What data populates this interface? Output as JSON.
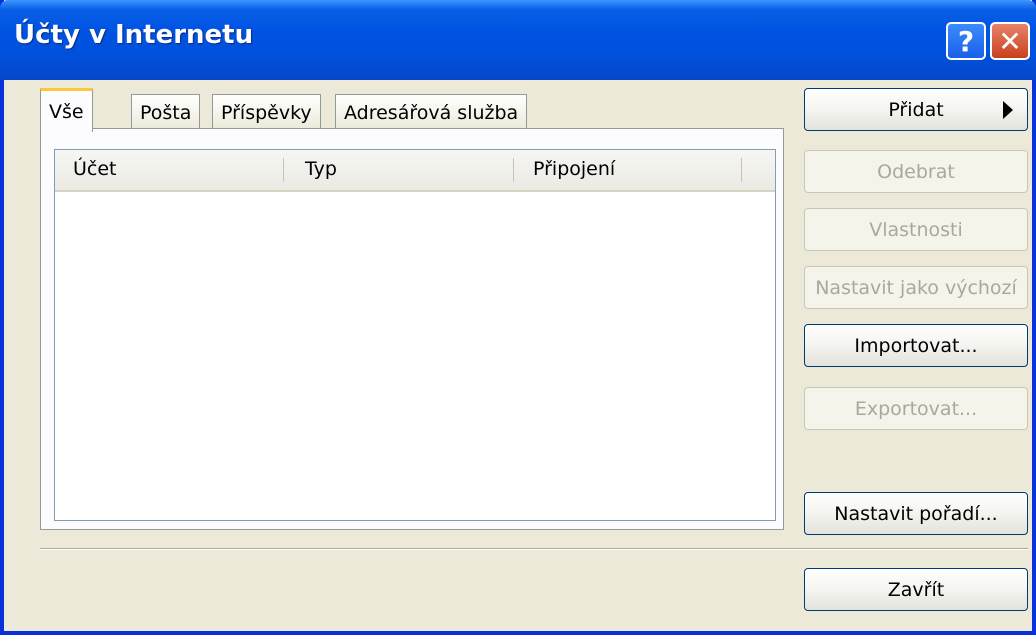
{
  "window": {
    "title": "Účty v Internetu",
    "help_glyph": "?",
    "close_glyph": "✕"
  },
  "tabs": [
    {
      "label": "Vše",
      "active": true
    },
    {
      "label": "Pošta",
      "active": false
    },
    {
      "label": "Příspěvky",
      "active": false
    },
    {
      "label": "Adresářová služba",
      "active": false
    }
  ],
  "list": {
    "columns": [
      "Účet",
      "Typ",
      "Připojení"
    ],
    "rows": []
  },
  "buttons": {
    "add": {
      "label": "Přidat",
      "enabled": true,
      "icon": "arrow-right-icon"
    },
    "remove": {
      "label": "Odebrat",
      "enabled": false
    },
    "properties": {
      "label": "Vlastnosti",
      "enabled": false
    },
    "set_default": {
      "label": "Nastavit jako výchozí",
      "enabled": false
    },
    "import": {
      "label": "Importovat...",
      "enabled": true
    },
    "export": {
      "label": "Exportovat...",
      "enabled": false
    },
    "set_order": {
      "label": "Nastavit pořadí...",
      "enabled": true
    },
    "close": {
      "label": "Zavřít",
      "enabled": true
    }
  },
  "colors": {
    "titlebar": "#0054e3",
    "dialog_bg": "#ece9d8",
    "active_tab_accent": "#ffc83c",
    "close_button": "#c8401e"
  }
}
